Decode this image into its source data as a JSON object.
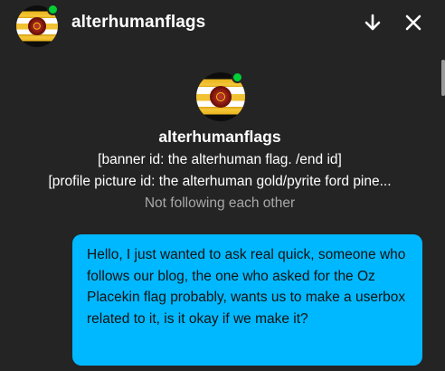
{
  "header": {
    "username": "alterhumanflags",
    "online": true,
    "down_icon": "arrow-down-icon",
    "close_icon": "close-icon"
  },
  "profile": {
    "username": "alterhumanflags",
    "bio_line_1": "[banner id: the alterhuman flag. /end id]",
    "bio_line_2": "[profile picture id: the alterhuman gold/pyrite ford pine...",
    "follow_status": "Not following each other"
  },
  "message": {
    "text": "Hello, I just wanted to ask real quick, someone who follows our blog, the one who asked for the Oz Placekin flag probably, wants us to make a userbox related to it, is it okay if we make it?"
  },
  "colors": {
    "background": "#242424",
    "bubble": "#00b8ff",
    "online_dot": "#00cf35",
    "muted_text": "#a8a8a8"
  }
}
